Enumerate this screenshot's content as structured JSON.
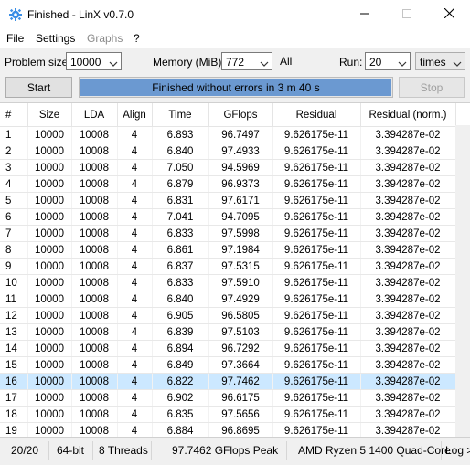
{
  "window": {
    "title": "Finished - LinX v0.7.0"
  },
  "menu": {
    "file": "File",
    "settings": "Settings",
    "graphs": "Graphs",
    "help": "?"
  },
  "controls": {
    "problem_size_label": "Problem size:",
    "problem_size_value": "10000",
    "memory_label": "Memory (MiB):",
    "memory_value": "772",
    "all_label": "All",
    "run_label": "Run:",
    "run_value": "20",
    "run_unit": "times",
    "start_label": "Start",
    "stop_label": "Stop",
    "progress_text": "Finished without errors in 3 m 40 s",
    "progress_fraction": 1.0,
    "progress_color": "#6b99d1"
  },
  "table": {
    "headers": [
      "#",
      "Size",
      "LDA",
      "Align",
      "Time",
      "GFlops",
      "Residual",
      "Residual (norm.)"
    ],
    "selected_row": 15,
    "rows": [
      [
        "1",
        "10000",
        "10008",
        "4",
        "6.893",
        "96.7497",
        "9.626175e-11",
        "3.394287e-02"
      ],
      [
        "2",
        "10000",
        "10008",
        "4",
        "6.840",
        "97.4933",
        "9.626175e-11",
        "3.394287e-02"
      ],
      [
        "3",
        "10000",
        "10008",
        "4",
        "7.050",
        "94.5969",
        "9.626175e-11",
        "3.394287e-02"
      ],
      [
        "4",
        "10000",
        "10008",
        "4",
        "6.879",
        "96.9373",
        "9.626175e-11",
        "3.394287e-02"
      ],
      [
        "5",
        "10000",
        "10008",
        "4",
        "6.831",
        "97.6171",
        "9.626175e-11",
        "3.394287e-02"
      ],
      [
        "6",
        "10000",
        "10008",
        "4",
        "7.041",
        "94.7095",
        "9.626175e-11",
        "3.394287e-02"
      ],
      [
        "7",
        "10000",
        "10008",
        "4",
        "6.833",
        "97.5998",
        "9.626175e-11",
        "3.394287e-02"
      ],
      [
        "8",
        "10000",
        "10008",
        "4",
        "6.861",
        "97.1984",
        "9.626175e-11",
        "3.394287e-02"
      ],
      [
        "9",
        "10000",
        "10008",
        "4",
        "6.837",
        "97.5315",
        "9.626175e-11",
        "3.394287e-02"
      ],
      [
        "10",
        "10000",
        "10008",
        "4",
        "6.833",
        "97.5910",
        "9.626175e-11",
        "3.394287e-02"
      ],
      [
        "11",
        "10000",
        "10008",
        "4",
        "6.840",
        "97.4929",
        "9.626175e-11",
        "3.394287e-02"
      ],
      [
        "12",
        "10000",
        "10008",
        "4",
        "6.905",
        "96.5805",
        "9.626175e-11",
        "3.394287e-02"
      ],
      [
        "13",
        "10000",
        "10008",
        "4",
        "6.839",
        "97.5103",
        "9.626175e-11",
        "3.394287e-02"
      ],
      [
        "14",
        "10000",
        "10008",
        "4",
        "6.894",
        "96.7292",
        "9.626175e-11",
        "3.394287e-02"
      ],
      [
        "15",
        "10000",
        "10008",
        "4",
        "6.849",
        "97.3664",
        "9.626175e-11",
        "3.394287e-02"
      ],
      [
        "16",
        "10000",
        "10008",
        "4",
        "6.822",
        "97.7462",
        "9.626175e-11",
        "3.394287e-02"
      ],
      [
        "17",
        "10000",
        "10008",
        "4",
        "6.902",
        "96.6175",
        "9.626175e-11",
        "3.394287e-02"
      ],
      [
        "18",
        "10000",
        "10008",
        "4",
        "6.835",
        "97.5656",
        "9.626175e-11",
        "3.394287e-02"
      ],
      [
        "19",
        "10000",
        "10008",
        "4",
        "6.884",
        "96.8695",
        "9.626175e-11",
        "3.394287e-02"
      ],
      [
        "20",
        "10000",
        "10008",
        "4",
        "6.825",
        "97.7070",
        "9.626175e-11",
        "3.394287e-02"
      ]
    ]
  },
  "status": {
    "count": "20/20",
    "bits": "64-bit",
    "threads": "8 Threads",
    "peak": "97.7462 GFlops Peak",
    "cpu": "AMD Ryzen 5 1400 Quad-Core",
    "log": "Log >"
  },
  "icons": {
    "app": "gear-icon",
    "minimize": "minimize-icon",
    "maximize": "maximize-icon",
    "close": "close-icon",
    "dropdown": "chevron-down-icon"
  }
}
